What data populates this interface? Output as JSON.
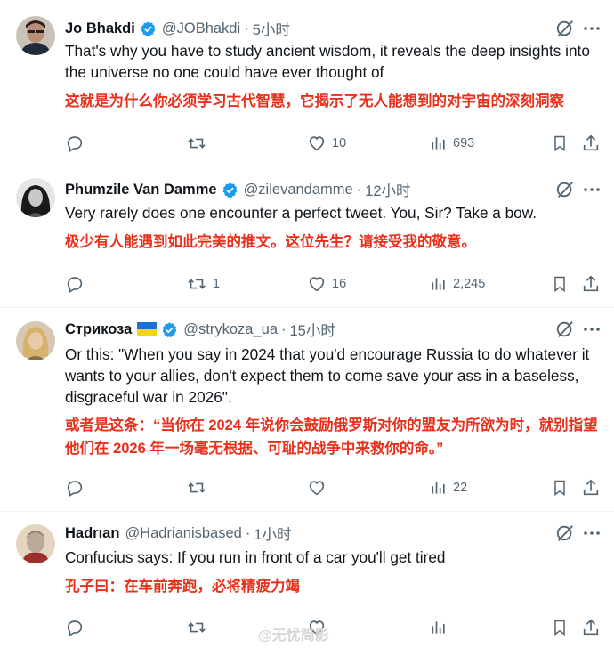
{
  "tweets": [
    {
      "name": "Jo Bhakdi",
      "handle": "@JOBhakdi",
      "time": "5小时",
      "text": "That's why you have to study ancient wisdom, it reveals the deep insights into the universe no one could have ever thought of",
      "translation": "这就是为什么你必须学习古代智慧，它揭示了无人能想到的对宇宙的深刻洞察",
      "replies": "",
      "reposts": "",
      "likes": "10",
      "views": "693"
    },
    {
      "name": "Phumzile Van Damme",
      "handle": "@zilevandamme",
      "time": "12小时",
      "text": "Very rarely does one encounter a perfect tweet. You, Sir? Take a bow.",
      "translation": "极少有人能遇到如此完美的推文。这位先生？请接受我的敬意。",
      "replies": "",
      "reposts": "1",
      "likes": "16",
      "views": "2,245"
    },
    {
      "name": "Стрикоза",
      "handle": "@strykoza_ua",
      "time": "15小时",
      "text": "Or this: \"When you say in 2024 that you'd encourage Russia to do whatever it wants to your allies, don't expect them to come save your ass in a baseless, disgraceful war in 2026\".",
      "translation": "或者是这条：“当你在 2024 年说你会鼓励俄罗斯对你的盟友为所欲为时，就别指望他们在 2026 年一场毫无根据、可耻的战争中来救你的命。”",
      "replies": "",
      "reposts": "",
      "likes": "",
      "views": "22"
    },
    {
      "name": "Hadrıan",
      "handle": "@Hadrianisbased",
      "time": "1小时",
      "text": "Confucius says: If you run in front of a car you'll get tired",
      "translation": "孔子曰：在车前奔跑，必将精疲力竭"
    }
  ],
  "separator": "·",
  "watermark": "@无忧简影",
  "colors": {
    "verified": "#1d9bf0",
    "translation": "#e8301c",
    "muted": "#536471"
  },
  "icons": [
    "verified-badge-icon",
    "grok-icon",
    "more-icon",
    "reply-icon",
    "repost-icon",
    "like-icon",
    "views-icon",
    "bookmark-icon",
    "share-icon",
    "ukraine-flag-icon"
  ]
}
